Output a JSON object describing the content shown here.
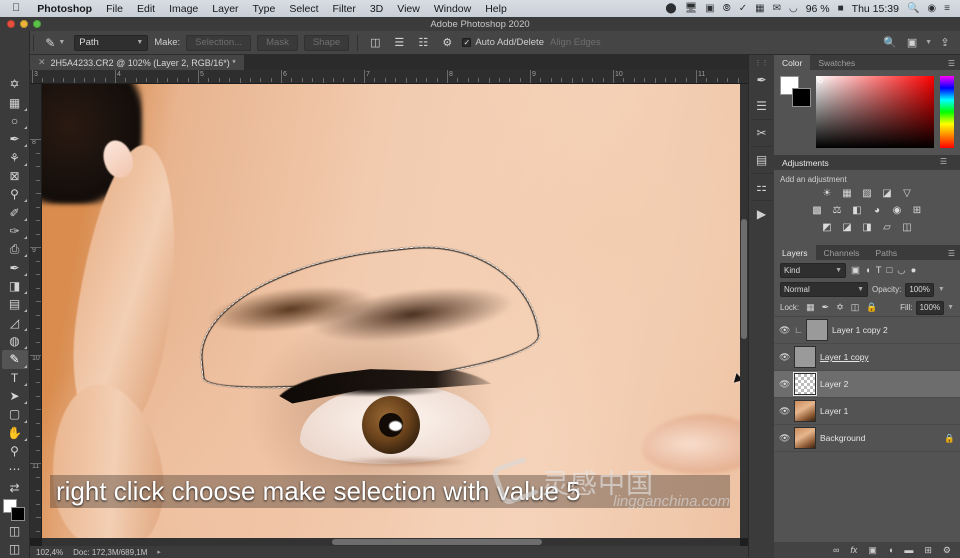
{
  "macmenu": {
    "apple_icon": "apple-icon",
    "items": [
      {
        "label": "Photoshop",
        "bold": true
      },
      {
        "label": "File"
      },
      {
        "label": "Edit"
      },
      {
        "label": "Image"
      },
      {
        "label": "Layer"
      },
      {
        "label": "Type"
      },
      {
        "label": "Select"
      },
      {
        "label": "Filter"
      },
      {
        "label": "3D"
      },
      {
        "label": "View"
      },
      {
        "label": "Window"
      },
      {
        "label": "Help"
      }
    ],
    "status": {
      "icons": [
        "record-icon",
        "display-icon",
        "screenshare-icon",
        "dropbox-icon",
        "shield-icon",
        "flag-icon",
        "bluetooth-icon",
        "wifi-icon"
      ],
      "battery_percent": "96 %",
      "battery_icon": "battery-icon",
      "clock": "Thu 15:39",
      "search_icon": "spotlight-search-icon",
      "siri_icon": "siri-icon",
      "controlcenter_icon": "control-center-icon"
    }
  },
  "window": {
    "title": "Adobe Photoshop 2020",
    "close_label": "close-button",
    "minimize_label": "minimize-button",
    "zoom_label": "zoom-button"
  },
  "options_bar": {
    "home_icon": "home-icon",
    "tool_icon": "pen-tool-icon",
    "mode_value": "Path",
    "make_label": "Make:",
    "selection_button": "Selection...",
    "mask_button": "Mask",
    "shape_button": "Shape",
    "path_ops_icon": "path-operations-icon",
    "path_align_icon": "path-alignment-icon",
    "path_arrange_icon": "path-arrangement-icon",
    "gear_icon": "gear-icon",
    "auto_add_delete": "Auto Add/Delete",
    "align_edges": "Align Edges",
    "search_icon": "search-icon",
    "workspace_icon": "workspace-icon",
    "share_icon": "share-icon"
  },
  "document": {
    "tab_title": "2H5A4233.CR2 @ 102% (Layer 2, RGB/16*) *",
    "close_icon": "close-tab-icon",
    "h_ruler_ticks": [
      "3",
      "4",
      "5",
      "6",
      "7",
      "8",
      "9",
      "10",
      "11"
    ],
    "v_ruler_ticks": [
      "8",
      "9",
      "10",
      "11"
    ],
    "subtitle": "right click choose make selection with value 5",
    "watermark_cn": "灵感中国",
    "watermark_url": "lingganchina.com"
  },
  "status_bar": {
    "zoom": "102,4%",
    "doc_size": "Doc: 172,3M/689,1M",
    "expand_icon": "expand-arrow-icon"
  },
  "toolbar": {
    "tools": [
      {
        "name": "move-tool",
        "glyph": "✥",
        "sub": false
      },
      {
        "name": "rectangular-marquee-tool",
        "glyph": "▭",
        "sub": true
      },
      {
        "name": "lasso-tool",
        "glyph": "◯",
        "sub": true
      },
      {
        "name": "object-selection-tool",
        "glyph": "✎",
        "sub": true
      },
      {
        "name": "crop-tool",
        "glyph": "⌗",
        "sub": true
      },
      {
        "name": "frame-tool",
        "glyph": "⊠",
        "sub": false
      },
      {
        "name": "eyedropper-tool",
        "glyph": "⚲",
        "sub": true
      },
      {
        "name": "spot-healing-brush-tool",
        "glyph": "✐",
        "sub": true
      },
      {
        "name": "brush-tool",
        "glyph": "🖌",
        "sub": true
      },
      {
        "name": "clone-stamp-tool",
        "glyph": "⎙",
        "sub": true
      },
      {
        "name": "history-brush-tool",
        "glyph": "✒",
        "sub": true
      },
      {
        "name": "eraser-tool",
        "glyph": "◨",
        "sub": true
      },
      {
        "name": "gradient-tool",
        "glyph": "▤",
        "sub": true
      },
      {
        "name": "blur-tool",
        "glyph": "◌",
        "sub": true
      },
      {
        "name": "dodge-tool",
        "glyph": "◍",
        "sub": true
      },
      {
        "name": "pen-tool",
        "glyph": "✑",
        "sub": true,
        "active": true
      },
      {
        "name": "type-tool",
        "glyph": "T",
        "sub": true
      },
      {
        "name": "path-selection-tool",
        "glyph": "➤",
        "sub": true
      },
      {
        "name": "rectangle-tool",
        "glyph": "▢",
        "sub": true
      },
      {
        "name": "hand-tool",
        "glyph": "✋",
        "sub": true
      },
      {
        "name": "zoom-tool",
        "glyph": "🔍",
        "sub": false
      }
    ],
    "more_icon": "edit-toolbar-icon",
    "default_colors_icon": "default-colors-icon",
    "swap_colors_icon": "swap-colors-icon",
    "foreground_color": "#ffffff",
    "background_color": "#000000",
    "quickmask_icon": "quick-mask-icon",
    "screenmode_icon": "screen-mode-icon"
  },
  "icon_dock": [
    {
      "name": "brush-settings-icon",
      "glyph": "🖌"
    },
    {
      "name": "adjustments-sliders-icon",
      "glyph": "🎛"
    },
    {
      "name": "tool-presets-icon",
      "glyph": "✂"
    },
    {
      "name": "histogram-icon",
      "glyph": "📊"
    },
    {
      "name": "info-panel-icon",
      "glyph": "ℹ"
    },
    {
      "name": "actions-play-icon",
      "glyph": "▶"
    }
  ],
  "color_panel": {
    "tabs": [
      {
        "label": "Color",
        "active": true
      },
      {
        "label": "Swatches",
        "active": false
      }
    ],
    "menu_icon": "panel-menu-icon",
    "foreground": "#ffffff",
    "background": "#000000",
    "hue": "#ff0000"
  },
  "adjustments_panel": {
    "title": "Adjustments",
    "menu_icon": "panel-menu-icon",
    "hint": "Add an adjustment",
    "rows": [
      [
        {
          "name": "brightness-contrast-icon",
          "glyph": "☀"
        },
        {
          "name": "levels-icon",
          "glyph": "▦"
        },
        {
          "name": "curves-icon",
          "glyph": "▨"
        },
        {
          "name": "exposure-icon",
          "glyph": "◪"
        },
        {
          "name": "vibrance-icon",
          "glyph": "▽"
        }
      ],
      [
        {
          "name": "hue-saturation-icon",
          "glyph": "▩"
        },
        {
          "name": "color-balance-icon",
          "glyph": "⚖"
        },
        {
          "name": "black-white-icon",
          "glyph": "◧"
        },
        {
          "name": "photo-filter-icon",
          "glyph": "◕"
        },
        {
          "name": "channel-mixer-icon",
          "glyph": "◉"
        },
        {
          "name": "color-lookup-icon",
          "glyph": "⊞"
        }
      ],
      [
        {
          "name": "invert-icon",
          "glyph": "◩"
        },
        {
          "name": "posterize-icon",
          "glyph": "◪"
        },
        {
          "name": "threshold-icon",
          "glyph": "◨"
        },
        {
          "name": "gradient-map-icon",
          "glyph": "◱"
        },
        {
          "name": "selective-color-icon",
          "glyph": "◫"
        }
      ]
    ]
  },
  "layers_panel": {
    "tabs": [
      {
        "label": "Layers",
        "active": true
      },
      {
        "label": "Channels",
        "active": false
      },
      {
        "label": "Paths",
        "active": false
      }
    ],
    "menu_icon": "panel-menu-icon",
    "filter_value": "Kind",
    "filter_icons": [
      "filter-pixel-icon",
      "filter-adjustment-icon",
      "filter-type-icon",
      "filter-shape-icon",
      "filter-smart-icon"
    ],
    "filter_toggle_icon": "filter-toggle-icon",
    "blend_mode": "Normal",
    "opacity_label": "Opacity:",
    "opacity_value": "100%",
    "lock_label": "Lock:",
    "lock_icons": [
      "lock-transparent-icon",
      "lock-image-icon",
      "lock-position-icon",
      "lock-artboard-icon",
      "lock-all-icon"
    ],
    "fill_label": "Fill:",
    "fill_value": "100%",
    "layers": [
      {
        "name": "Layer 1 copy 2",
        "visible": true,
        "clipped": true,
        "thumb": "gray",
        "selected": false,
        "locked": false,
        "underline": false
      },
      {
        "name": "Layer 1 copy",
        "visible": true,
        "clipped": false,
        "thumb": "gray",
        "selected": false,
        "locked": false,
        "underline": true
      },
      {
        "name": "Layer 2",
        "visible": true,
        "clipped": false,
        "thumb": "transparent",
        "selected": true,
        "locked": false,
        "underline": false
      },
      {
        "name": "Layer 1",
        "visible": true,
        "clipped": false,
        "thumb": "face",
        "selected": false,
        "locked": false,
        "underline": false
      },
      {
        "name": "Background",
        "visible": true,
        "clipped": false,
        "thumb": "face",
        "selected": false,
        "locked": true,
        "underline": false
      }
    ],
    "footer_icons": [
      {
        "name": "link-layers-icon",
        "glyph": "🔗"
      },
      {
        "name": "layer-style-fx-icon",
        "glyph": "fx"
      },
      {
        "name": "add-layer-mask-icon",
        "glyph": "▣"
      },
      {
        "name": "new-adjustment-layer-icon",
        "glyph": "◑"
      },
      {
        "name": "new-group-icon",
        "glyph": "▬"
      },
      {
        "name": "new-layer-icon",
        "glyph": "⊞"
      },
      {
        "name": "delete-layer-icon",
        "glyph": "🗑"
      }
    ]
  }
}
